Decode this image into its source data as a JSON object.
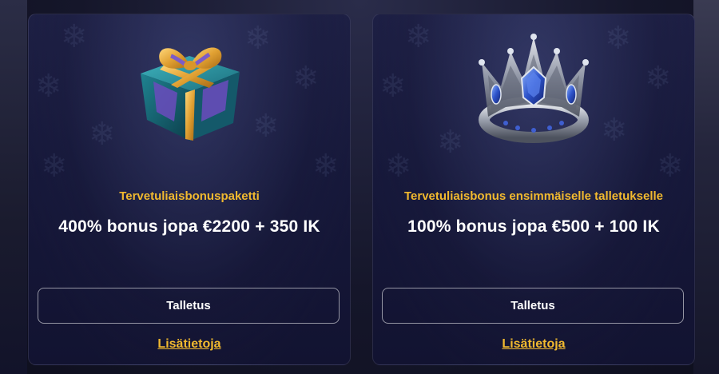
{
  "offers": [
    {
      "icon": "gift-box-icon",
      "subtitle": "Tervetuliaisbonuspaketti",
      "headline": "400% bonus jopa €2200 + 350 IK",
      "button_label": "Talletus",
      "link_label": "Lisätietoja"
    },
    {
      "icon": "crown-icon",
      "subtitle": "Tervetuliaisbonus ensimmäiselle talletukselle",
      "headline": "100% bonus jopa €500 + 100 IK",
      "button_label": "Talletus",
      "link_label": "Lisätietoja"
    }
  ],
  "colors": {
    "accent": "#f1b92f",
    "card_background": "#17193a",
    "text": "#ffffff"
  }
}
